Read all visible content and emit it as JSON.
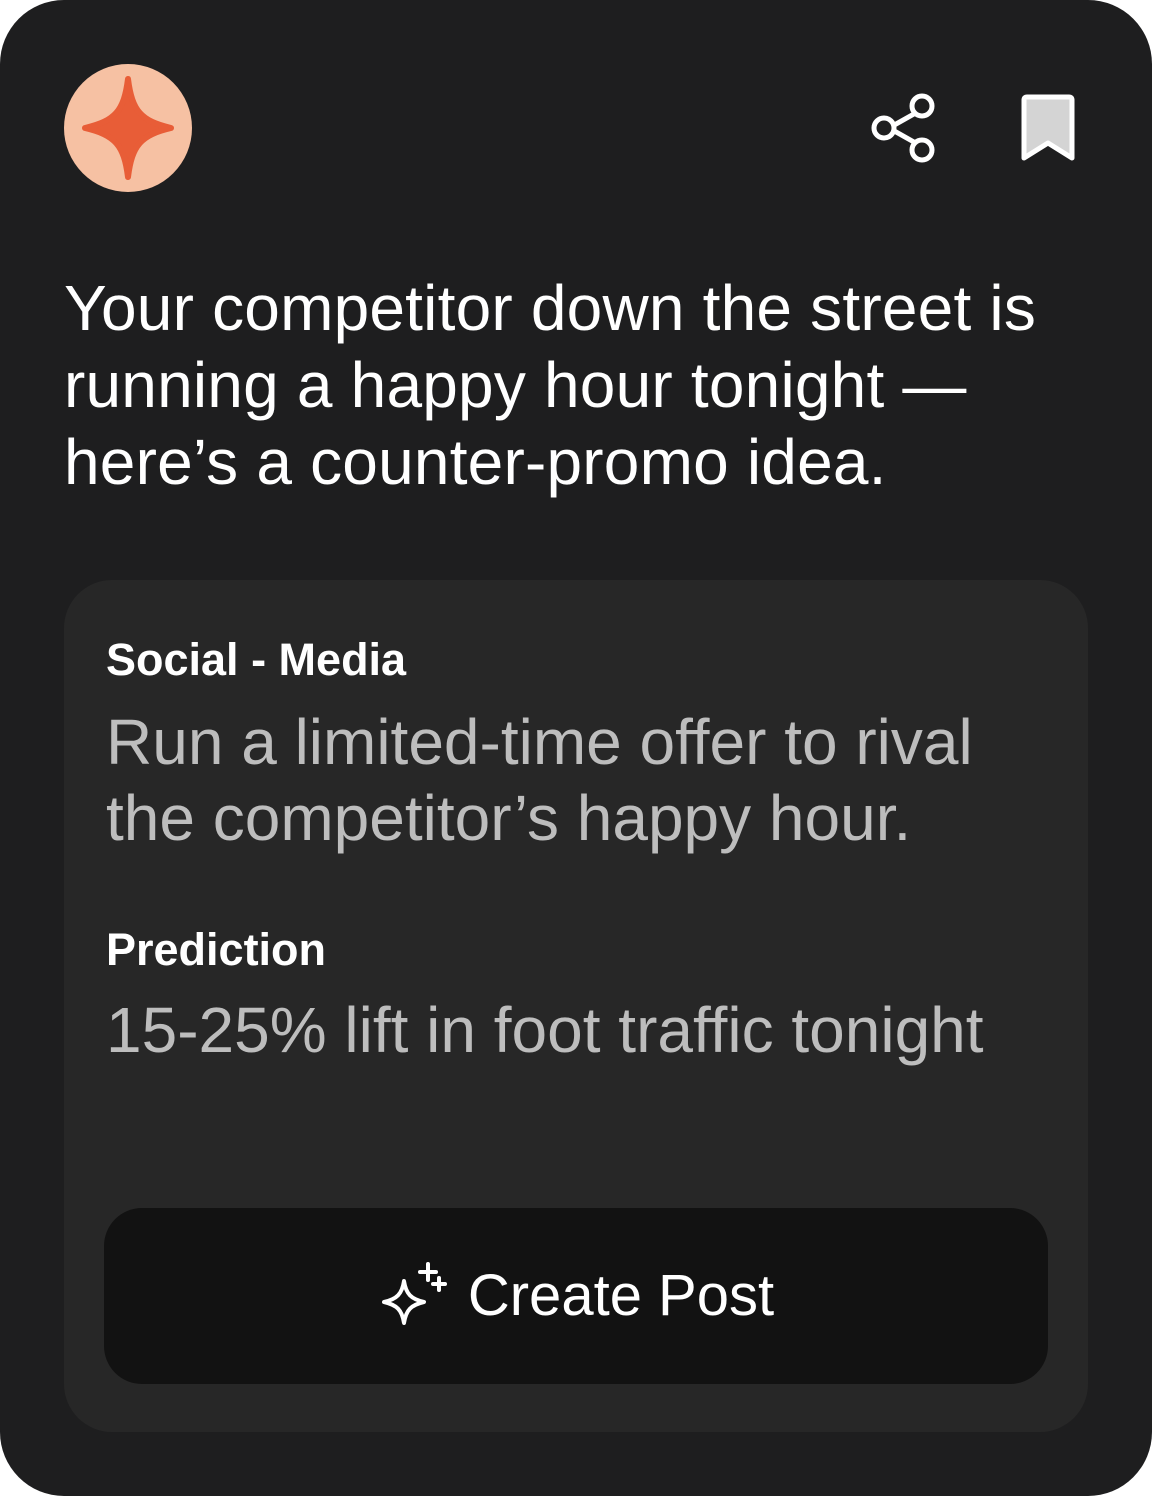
{
  "card": {
    "avatar_icon": "sparkle-star-icon",
    "avatar_bg": "#f6c1a3",
    "avatar_star_color": "#e85d37",
    "actions": {
      "share_icon": "share-icon",
      "bookmark_icon": "bookmark-icon"
    },
    "headline": "Your competitor down the street is running a happy hour tonight — here’s a counter-promo idea.",
    "suggestion": {
      "category_label": "Social - Media",
      "category_text": "Run a limited-time offer to rival the competitor’s happy hour.",
      "prediction_label": "Prediction",
      "prediction_text": "15-25% lift in foot traffic tonight"
    },
    "cta": {
      "label": "Create Post",
      "icon": "sparkles-icon"
    }
  },
  "colors": {
    "card_bg": "#1e1e1f",
    "panel_bg": "#272727",
    "button_bg": "#121212",
    "text_primary": "#ffffff",
    "text_secondary": "#bdbdbd"
  }
}
